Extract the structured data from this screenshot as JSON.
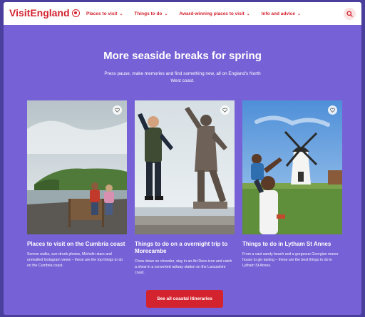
{
  "brand": {
    "name": "VisitEngland"
  },
  "nav": {
    "items": [
      {
        "label": "Places to visit",
        "chevron": "chevron-down-icon"
      },
      {
        "label": "Things to do",
        "chevron": "chevron-down-icon"
      },
      {
        "label": "Award-winning places to visit",
        "chevron": "chevron-down-icon"
      },
      {
        "label": "Info and advice",
        "chevron": "chevron-down-icon"
      }
    ],
    "search_icon": "search-icon"
  },
  "section": {
    "title": "More seaside breaks for spring",
    "intro": "Press pause, make memories and find something new, all on England's North West coast."
  },
  "cards": [
    {
      "title": "Places to visit on the Cumbria coast",
      "description": "Serene walks, sun-drunk photos, Michelin stars and unrivalled Instagram views – these are the top things to do on the Cumbria coast.",
      "favourite_icon": "heart-icon"
    },
    {
      "title": "Things to do on a overnight trip to Morecambe",
      "description": "Chow down on chowder, stay in an Art Deco icon and catch a show in a converted railway station on the Lancashire coast.",
      "favourite_icon": "heart-icon"
    },
    {
      "title": "Things to do in Lytham St Annes",
      "description": "From a vast sandy beach and a gorgeous Georgian manor house to gin tasting – these are the best things to do in Lytham St Annes.",
      "favourite_icon": "heart-icon"
    }
  ],
  "cta": {
    "label": "See all coastal itineraries"
  },
  "colors": {
    "brand_red": "#d3232f",
    "section_bg": "#7662d6",
    "header_bg": "#ffffff"
  }
}
